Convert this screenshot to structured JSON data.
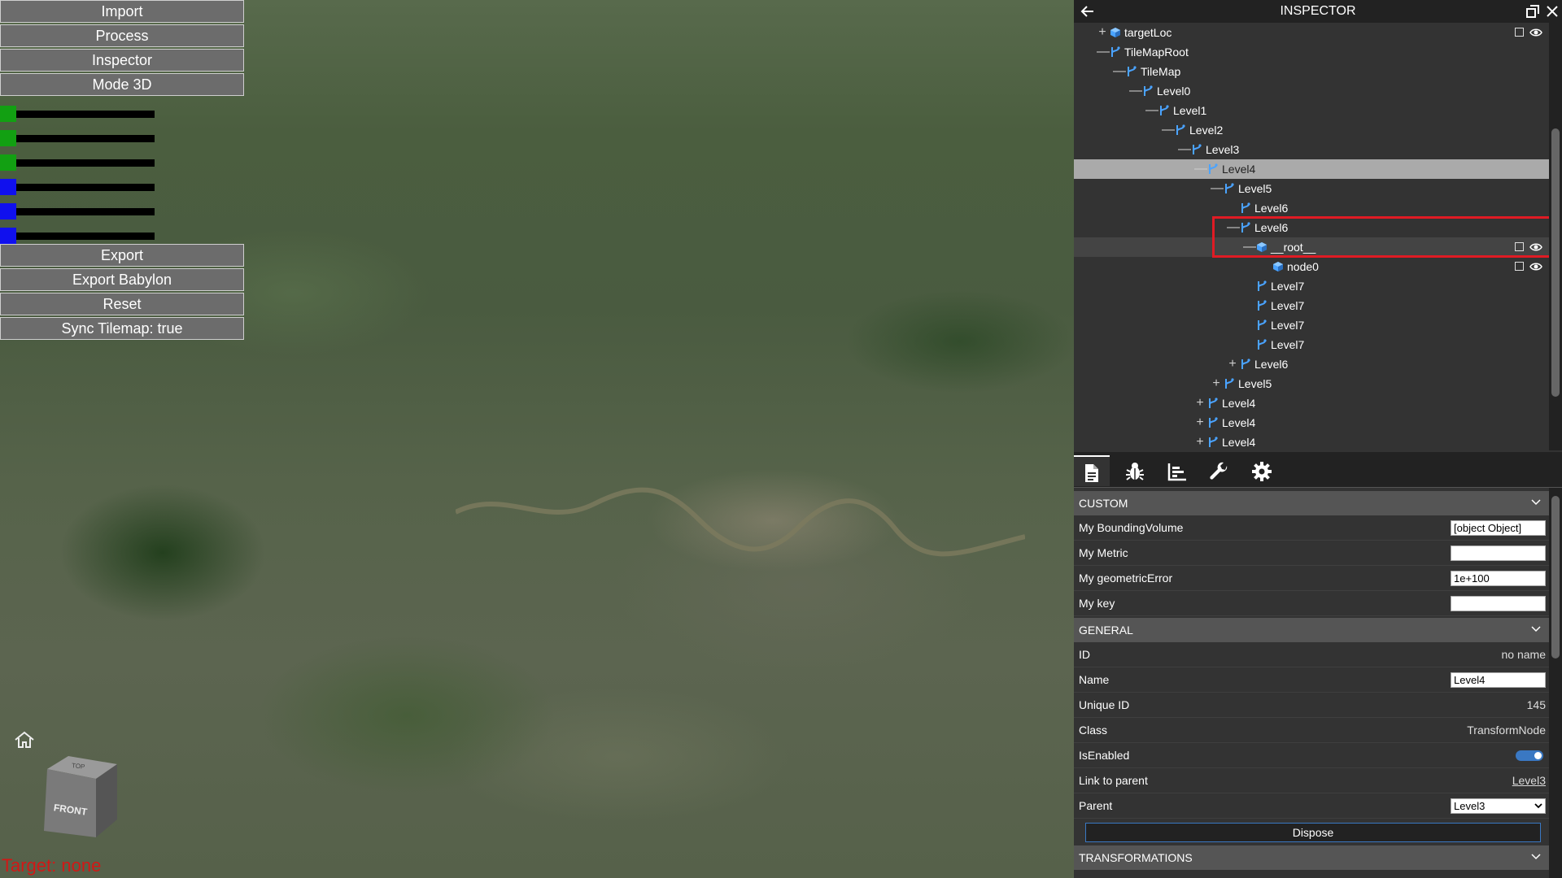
{
  "left_panel": {
    "buttons_top": [
      "Import",
      "Process",
      "Inspector",
      "Mode 3D"
    ],
    "sliders": [
      {
        "color": "#12a012"
      },
      {
        "color": "#12a012"
      },
      {
        "color": "#12a012"
      },
      {
        "color": "#1010ee"
      },
      {
        "color": "#1010ee"
      },
      {
        "color": "#1010ee"
      }
    ],
    "buttons_bottom": [
      "Export",
      "Export Babylon",
      "Reset",
      "Sync Tilemap: true"
    ]
  },
  "viewport": {
    "nav_cube": {
      "top_face": "TOP",
      "front_face": "FRONT"
    },
    "target_text": "Target: none"
  },
  "inspector": {
    "title": "INSPECTOR",
    "tree": [
      {
        "label": "targetLoc",
        "toggle": "+",
        "icon": "mesh",
        "actions": true
      },
      {
        "label": "TileMapRoot",
        "toggle": "—",
        "icon": "node"
      },
      {
        "label": "TileMap",
        "toggle": "—",
        "icon": "node"
      },
      {
        "label": "Level0",
        "toggle": "—",
        "icon": "node"
      },
      {
        "label": "Level1",
        "toggle": "—",
        "icon": "node"
      },
      {
        "label": "Level2",
        "toggle": "—",
        "icon": "node"
      },
      {
        "label": "Level3",
        "toggle": "—",
        "icon": "node"
      },
      {
        "label": "Level4",
        "toggle": "—",
        "icon": "node",
        "selected": true
      },
      {
        "label": "Level5",
        "toggle": "—",
        "icon": "node"
      },
      {
        "label": "Level6",
        "toggle": "",
        "icon": "node"
      },
      {
        "label": "Level6",
        "toggle": "—",
        "icon": "node"
      },
      {
        "label": "__root__",
        "toggle": "—",
        "icon": "mesh",
        "actions": true,
        "hovered": true
      },
      {
        "label": "node0",
        "toggle": "",
        "icon": "mesh",
        "actions": true
      },
      {
        "label": "Level7",
        "toggle": "",
        "icon": "node"
      },
      {
        "label": "Level7",
        "toggle": "",
        "icon": "node"
      },
      {
        "label": "Level7",
        "toggle": "",
        "icon": "node"
      },
      {
        "label": "Level7",
        "toggle": "",
        "icon": "node"
      },
      {
        "label": "Level6",
        "toggle": "+",
        "icon": "node"
      },
      {
        "label": "Level5",
        "toggle": "+",
        "icon": "node"
      },
      {
        "label": "Level4",
        "toggle": "+",
        "icon": "node"
      },
      {
        "label": "Level4",
        "toggle": "+",
        "icon": "node"
      },
      {
        "label": "Level4",
        "toggle": "+",
        "icon": "node"
      }
    ],
    "tabs": [
      "properties-tab",
      "debug-tab",
      "statistics-tab",
      "tools-tab",
      "settings-tab"
    ],
    "sections": {
      "custom": {
        "title": "CUSTOM",
        "rows": [
          {
            "label": "My BoundingVolume",
            "value": "[object Object]"
          },
          {
            "label": "My Metric",
            "value": ""
          },
          {
            "label": "My geometricError",
            "value": "1e+100"
          },
          {
            "label": "My key",
            "value": ""
          }
        ]
      },
      "general": {
        "title": "GENERAL",
        "id_label": "ID",
        "id_value": "no name",
        "name_label": "Name",
        "name_value": "Level4",
        "uid_label": "Unique ID",
        "uid_value": "145",
        "class_label": "Class",
        "class_value": "TransformNode",
        "enabled_label": "IsEnabled",
        "link_label": "Link to parent",
        "link_value": "Level3",
        "parent_label": "Parent",
        "parent_value": "Level3",
        "dispose_label": "Dispose"
      },
      "transformations": {
        "title": "TRANSFORMATIONS"
      }
    },
    "accent_color": "#3a78c3",
    "highlight_color": "#e01b24"
  }
}
